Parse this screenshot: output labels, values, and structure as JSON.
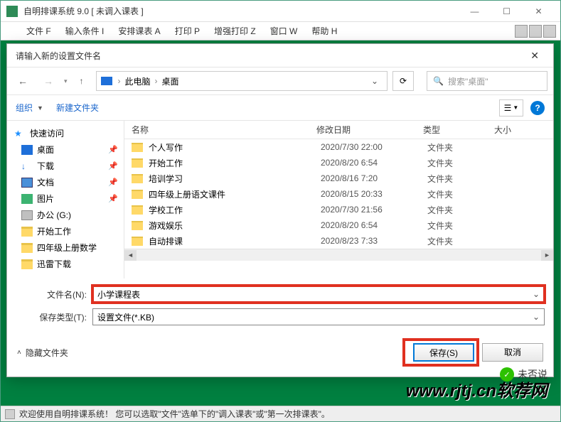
{
  "outer": {
    "title": "自明排课系统 9.0 [ 未调入课表 ]",
    "menus": [
      "文件 F",
      "输入条件 I",
      "安排课表 A",
      "打印 P",
      "增强打印 Z",
      "窗口 W",
      "帮助 H"
    ],
    "winbtns": {
      "min": "—",
      "max": "☐",
      "close": "✕"
    }
  },
  "dialog": {
    "title": "请输入新的设置文件名",
    "close": "✕",
    "nav": {
      "back": "←",
      "forward": "→",
      "up": "↑",
      "crumb_root": "此电脑",
      "crumb_leaf": "桌面",
      "refresh": "⟳",
      "search_placeholder": "搜索\"桌面\""
    },
    "toolbar": {
      "organize": "组织",
      "newfolder": "新建文件夹",
      "help": "?"
    },
    "navpane": {
      "quick": "快速访问",
      "items": [
        {
          "label": "桌面",
          "icon": "desktop",
          "pin": true
        },
        {
          "label": "下载",
          "icon": "dl",
          "pin": true
        },
        {
          "label": "文档",
          "icon": "doc",
          "pin": true
        },
        {
          "label": "图片",
          "icon": "pic",
          "pin": true
        },
        {
          "label": "办公 (G:)",
          "icon": "drive",
          "pin": false
        },
        {
          "label": "开始工作",
          "icon": "folder",
          "pin": false
        },
        {
          "label": "四年级上册数学",
          "icon": "folder",
          "pin": false
        },
        {
          "label": "迅雷下载",
          "icon": "folder",
          "pin": false
        }
      ]
    },
    "columns": {
      "name": "名称",
      "date": "修改日期",
      "type": "类型",
      "size": "大小"
    },
    "files": [
      {
        "name": "个人写作",
        "date": "2020/7/30 22:00",
        "type": "文件夹"
      },
      {
        "name": "开始工作",
        "date": "2020/8/20 6:54",
        "type": "文件夹"
      },
      {
        "name": "培训学习",
        "date": "2020/8/16 7:20",
        "type": "文件夹"
      },
      {
        "name": "四年级上册语文课件",
        "date": "2020/8/15 20:33",
        "type": "文件夹"
      },
      {
        "name": "学校工作",
        "date": "2020/7/30 21:56",
        "type": "文件夹"
      },
      {
        "name": "游戏娱乐",
        "date": "2020/8/20 6:54",
        "type": "文件夹"
      },
      {
        "name": "自动排课",
        "date": "2020/8/23 7:33",
        "type": "文件夹"
      }
    ],
    "form": {
      "filename_label": "文件名(N):",
      "filename_value": "小学课程表",
      "filetype_label": "保存类型(T):",
      "filetype_value": "设置文件(*.KB)"
    },
    "footer": {
      "hide": "隐藏文件夹",
      "save": "保存(S)",
      "cancel": "取消"
    }
  },
  "statusbar": {
    "text": "欢迎使用自明排课系统！  您可以选取\"文件\"选单下的\"调入课表\"或\"第一次排课表\"。"
  },
  "watermark": {
    "url": "www.rjtj.cn软荐网",
    "wx": "未否说"
  }
}
